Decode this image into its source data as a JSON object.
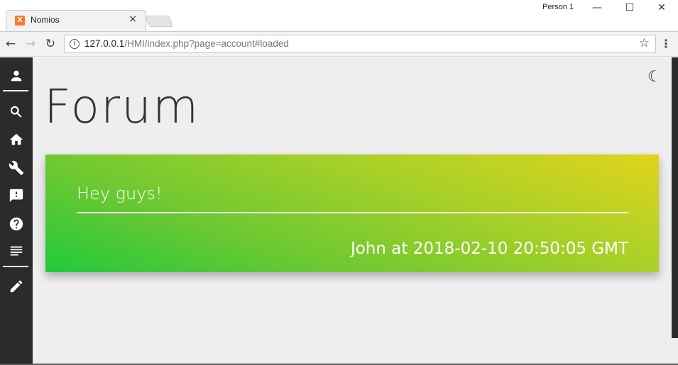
{
  "browser": {
    "tab_title": "Nomios",
    "tab_close": "×",
    "profile_name": "Person 1",
    "window_controls": {
      "minimize": "—",
      "maximize": "☐",
      "close": "✕"
    },
    "url_host": "127.0.0.1",
    "url_path": "/HMI/index.php?page=account#loaded",
    "nav": {
      "back": "←",
      "forward": "→",
      "reload": "↻"
    },
    "star": "☆",
    "menu": "⋮",
    "info": "i",
    "favicon": "X"
  },
  "sidebar": {
    "items": [
      {
        "name": "account",
        "icon": "person-icon"
      },
      {
        "name": "search",
        "icon": "search-icon"
      },
      {
        "name": "home",
        "icon": "home-icon"
      },
      {
        "name": "tools",
        "icon": "wrench-icon"
      },
      {
        "name": "feedback",
        "icon": "feedback-icon"
      },
      {
        "name": "help",
        "icon": "help-icon"
      },
      {
        "name": "forum",
        "icon": "lines-icon"
      },
      {
        "name": "edit",
        "icon": "pencil-icon"
      }
    ]
  },
  "theme_toggle": {
    "icon": "moon-icon",
    "glyph": "☽"
  },
  "page": {
    "title": "Forum"
  },
  "post": {
    "title": "Hey guys!",
    "meta": "John at 2018-02-10 20:50:05 GMT",
    "gradient_colors": [
      "#21c93c",
      "#6ac832",
      "#a8d028",
      "#e1d41c"
    ]
  },
  "colors": {
    "sidebar_bg": "#2b2b2b",
    "content_bg": "#eeeeee",
    "title_text": "#333333"
  }
}
